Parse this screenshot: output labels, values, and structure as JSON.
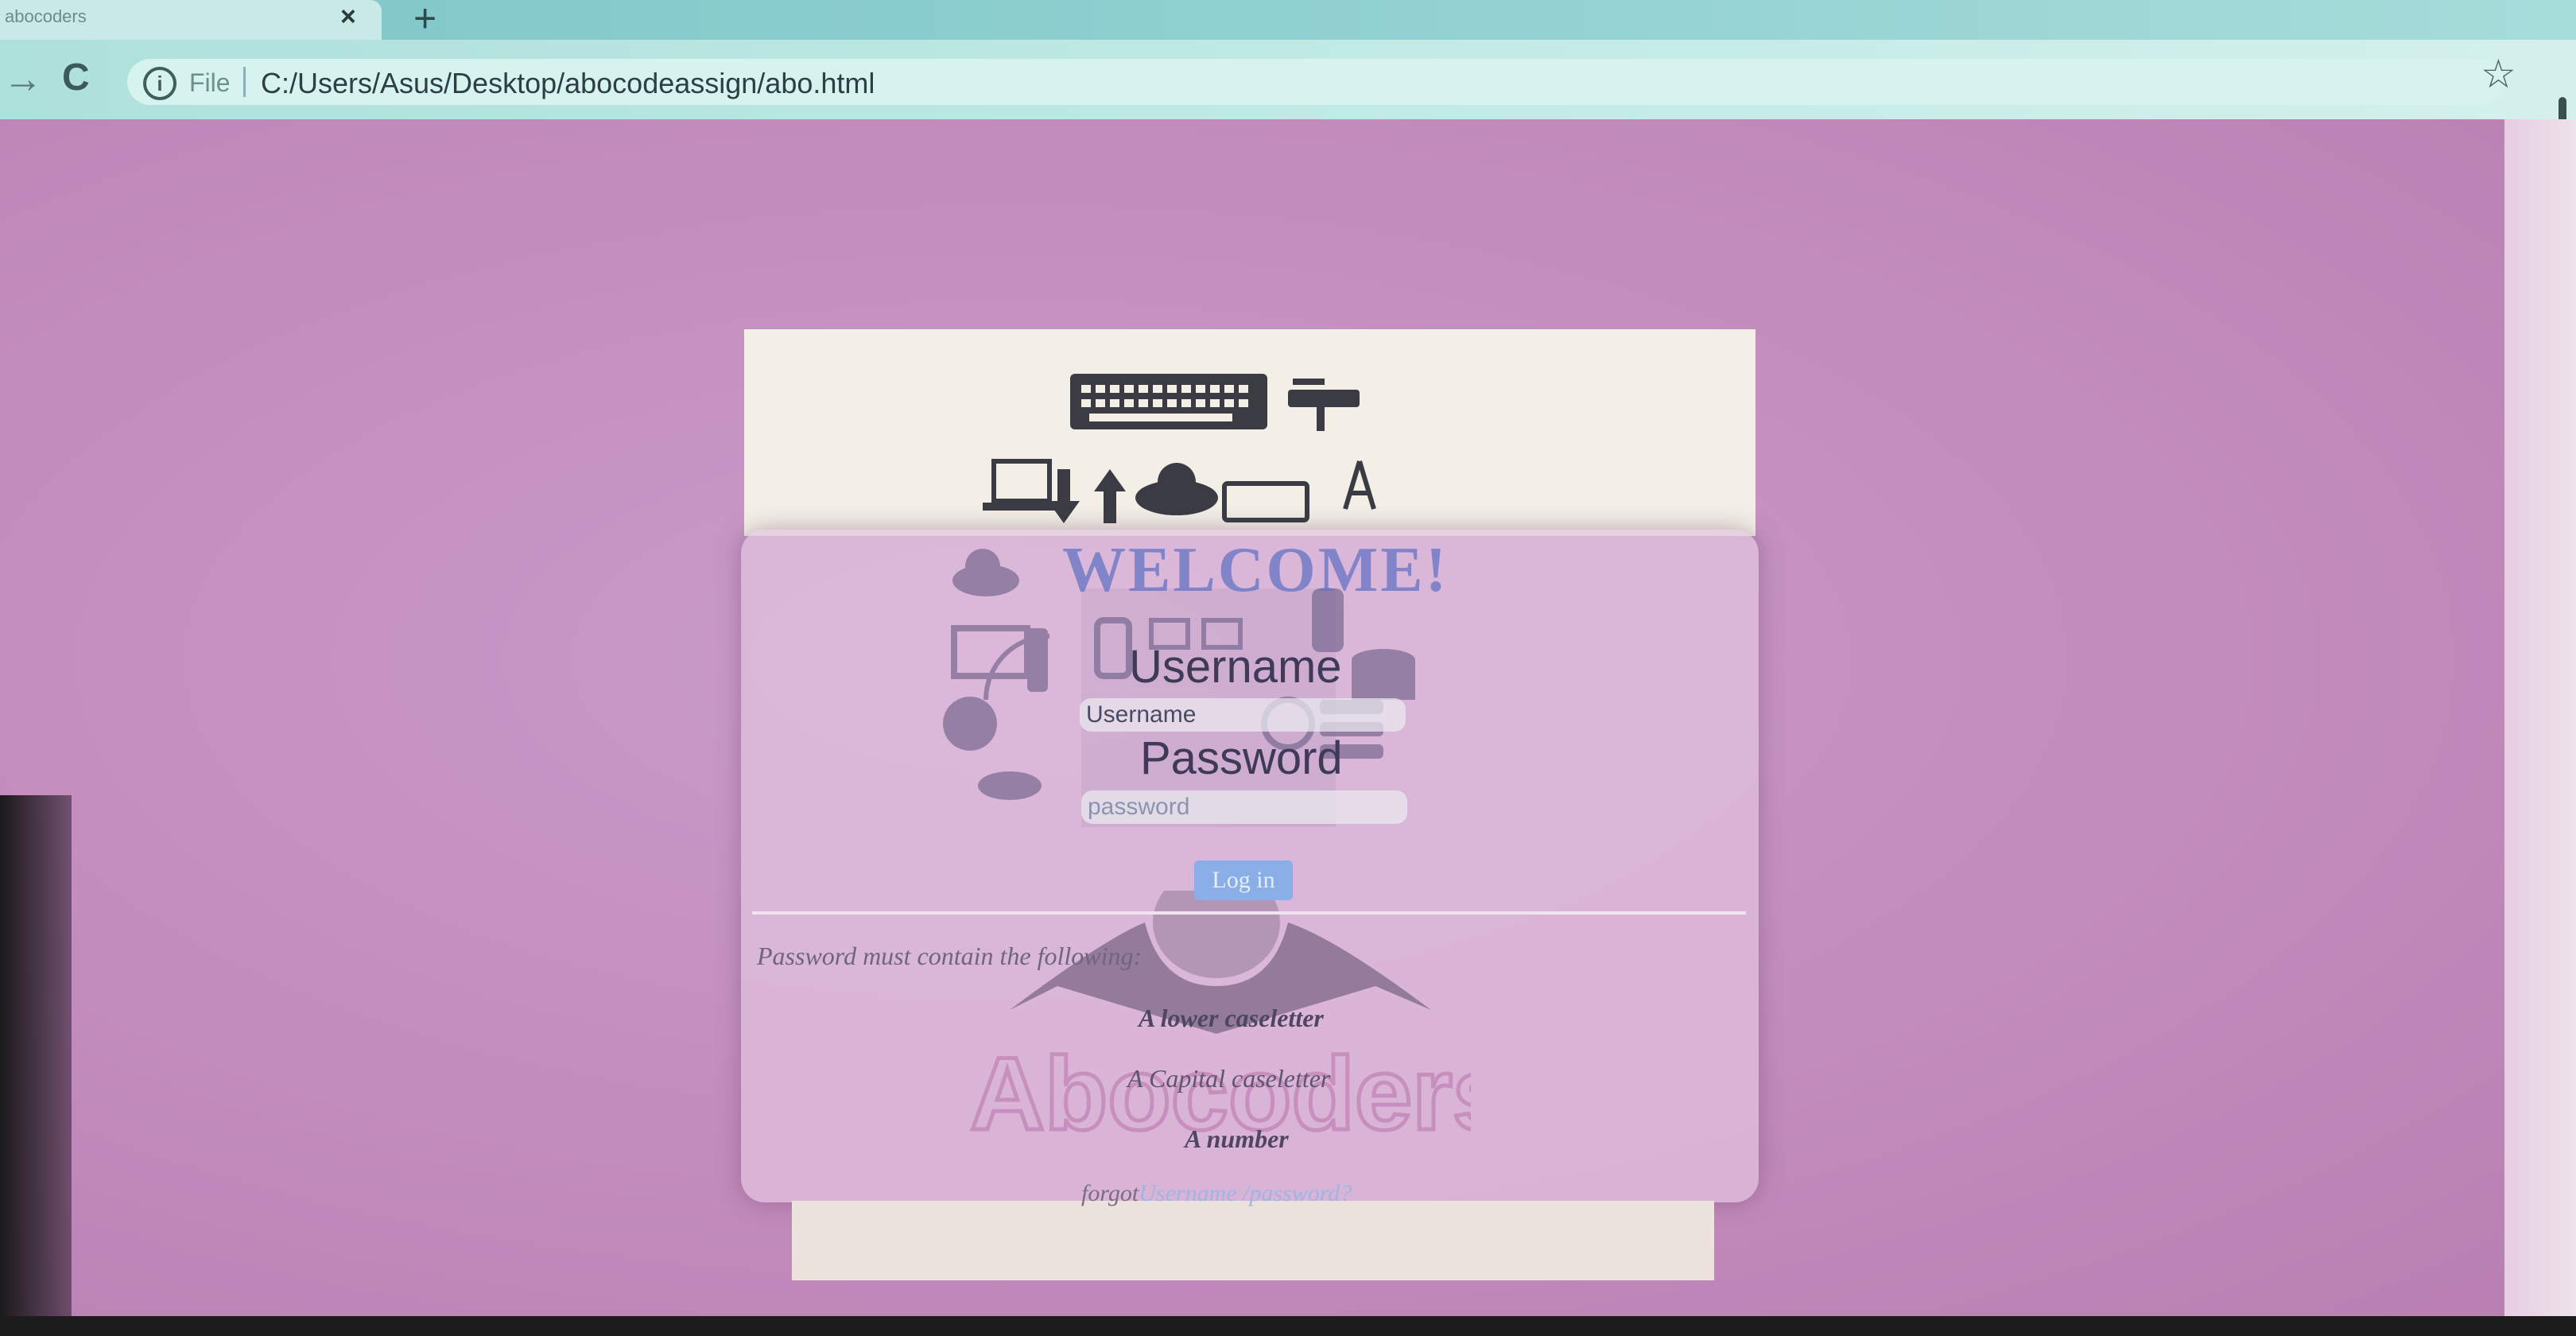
{
  "browser": {
    "tab_title": "abocoders",
    "tab_close": "×",
    "new_tab": "+",
    "forward_icon": "→",
    "reload_icon": "C",
    "info_icon": "i",
    "file_label": "File",
    "url": "C:/Users/Asus/Desktop/abocodeassign/abo.html",
    "star_icon": "☆"
  },
  "login": {
    "welcome": "WELCOME!",
    "username_label": "Username",
    "username_placeholder": "Username",
    "password_label": "Password",
    "password_placeholder": "password",
    "login_button": "Log in"
  },
  "requirements": {
    "title": "Password must contain the following:",
    "items": [
      "A lower caseletter",
      "A Capital caseletter",
      "A number"
    ]
  },
  "forgot": {
    "prefix": "forgot",
    "link": "Username /password?"
  },
  "logo_text": "Abocoders",
  "colors": {
    "page_background": "#c48fbf",
    "card_background": "#e2c4e0",
    "accent": "#6976c4",
    "button": "#8aaee6"
  }
}
